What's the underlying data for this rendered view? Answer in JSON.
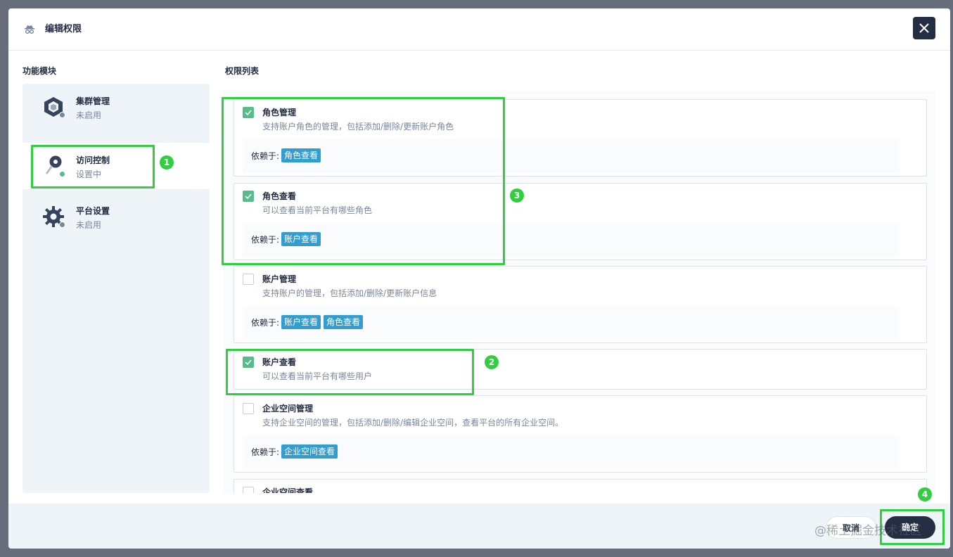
{
  "dialog": {
    "title": "编辑权限",
    "icon": "spy-hat-icon",
    "close_icon": "close-icon"
  },
  "sections": {
    "modules_label": "功能模块",
    "permissions_label": "权限列表"
  },
  "modules": [
    {
      "title": "集群管理",
      "status": "未启用",
      "icon": "cluster-cube-icon",
      "status_color": "#79879c",
      "active": false
    },
    {
      "title": "访问控制",
      "status": "设置中",
      "icon": "key-icon",
      "status_color": "#55bc8a",
      "active": true
    },
    {
      "title": "平台设置",
      "status": "未启用",
      "icon": "gear-icon",
      "status_color": "#79879c",
      "active": false
    }
  ],
  "permissions": [
    {
      "name": "角色管理",
      "desc": "支持账户角色的管理，包括添加/删除/更新账户角色",
      "checked": true,
      "dep_label": "依赖于:",
      "deps": [
        "角色查看"
      ]
    },
    {
      "name": "角色查看",
      "desc": "可以查看当前平台有哪些角色",
      "checked": true,
      "dep_label": "依赖于:",
      "deps": [
        "账户查看"
      ]
    },
    {
      "name": "账户管理",
      "desc": "支持账户的管理，包括添加/删除/更新账户信息",
      "checked": false,
      "dep_label": "依赖于:",
      "deps": [
        "账户查看",
        "角色查看"
      ]
    },
    {
      "name": "账户查看",
      "desc": "可以查看当前平台有哪些用户",
      "checked": true
    },
    {
      "name": "企业空间管理",
      "desc": "支持企业空间的管理，包括添加/删除/编辑企业空间，查看平台的所有企业空间。",
      "checked": false,
      "dep_label": "依赖于:",
      "deps": [
        "企业空间查看"
      ]
    },
    {
      "name": "企业空间查看",
      "desc": "",
      "checked": false
    }
  ],
  "footer": {
    "cancel_label": "取消",
    "ok_label": "确定"
  },
  "annotations": [
    "1",
    "2",
    "3",
    "4"
  ],
  "watermark": "@稀土掘金技术社区",
  "colors": {
    "highlight": "#2fcf3f",
    "tag": "#329dce",
    "checked": "#55bc8a",
    "primary": "#242e42"
  }
}
